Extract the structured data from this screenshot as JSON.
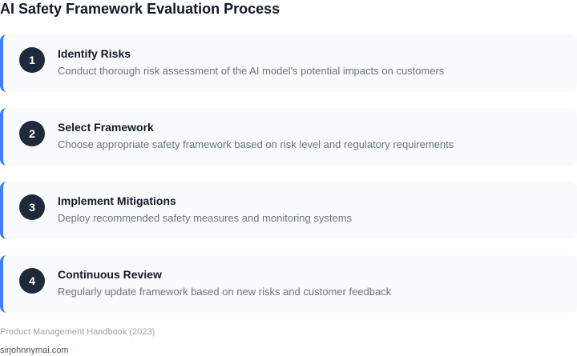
{
  "title": "AI Safety Framework Evaluation Process",
  "steps": [
    {
      "number": "1",
      "heading": "Identify Risks",
      "description": "Conduct thorough risk assessment of the AI model's potential impacts on customers"
    },
    {
      "number": "2",
      "heading": "Select Framework",
      "description": "Choose appropriate safety framework based on risk level and regulatory requirements"
    },
    {
      "number": "3",
      "heading": "Implement Mitigations",
      "description": "Deploy recommended safety measures and monitoring systems"
    },
    {
      "number": "4",
      "heading": "Continuous Review",
      "description": "Regularly update framework based on new risks and customer feedback"
    }
  ],
  "footer": {
    "source": "Product Management Handbook (2023)",
    "site": "sirjohnnymai.com"
  },
  "colors": {
    "accent": "#3b82f6",
    "badge": "#1e293b",
    "card_background": "#f8fafc"
  }
}
